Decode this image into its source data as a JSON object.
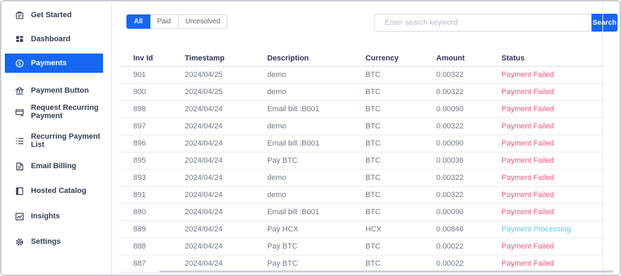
{
  "sidebar": {
    "items": [
      {
        "label": "Get Started",
        "icon": "clipboard-icon",
        "active": false
      },
      {
        "label": "Dashboard",
        "icon": "dashboard-icon",
        "active": false
      },
      {
        "label": "Payments",
        "icon": "payments-dollar-icon",
        "active": true
      },
      {
        "label": "Payment Button",
        "icon": "bank-icon",
        "active": false
      },
      {
        "label": "Request Recurring Payment",
        "icon": "card-icon",
        "active": false
      },
      {
        "label": "Recurring Payment List",
        "icon": "list-icon",
        "active": false
      },
      {
        "label": "Email Billing",
        "icon": "document-icon",
        "active": false
      },
      {
        "label": "Hosted Catalog",
        "icon": "book-icon",
        "active": false
      },
      {
        "label": "Insights",
        "icon": "chart-icon",
        "active": false
      },
      {
        "label": "Settings",
        "icon": "gear-icon",
        "active": false
      }
    ]
  },
  "filters": {
    "tabs": [
      {
        "label": "All",
        "active": true
      },
      {
        "label": "Paid",
        "active": false
      },
      {
        "label": "Unresolved",
        "active": false
      }
    ]
  },
  "search": {
    "placeholder": "Enter search keyword",
    "button_label": "Search"
  },
  "table": {
    "columns": [
      "Inv Id",
      "Timestamp",
      "Description",
      "Currency",
      "Amount",
      "Status"
    ],
    "rows": [
      {
        "inv_id": "901",
        "timestamp": "2024/04/25",
        "description": "demo",
        "currency": "BTC",
        "amount": "0.00322",
        "status": "Payment Failed"
      },
      {
        "inv_id": "900",
        "timestamp": "2024/04/25",
        "description": "demo",
        "currency": "BTC",
        "amount": "0.00322",
        "status": "Payment Failed"
      },
      {
        "inv_id": "898",
        "timestamp": "2024/04/24",
        "description": "Email bill :B001",
        "currency": "BTC",
        "amount": "0.00090",
        "status": "Payment Failed"
      },
      {
        "inv_id": "897",
        "timestamp": "2024/04/24",
        "description": "demo",
        "currency": "BTC",
        "amount": "0.00322",
        "status": "Payment Failed"
      },
      {
        "inv_id": "896",
        "timestamp": "2024/04/24",
        "description": "Email bill :B001",
        "currency": "BTC",
        "amount": "0.00090",
        "status": "Payment Failed"
      },
      {
        "inv_id": "895",
        "timestamp": "2024/04/24",
        "description": "Pay BTC",
        "currency": "BTC",
        "amount": "0.00036",
        "status": "Payment Failed"
      },
      {
        "inv_id": "893",
        "timestamp": "2024/04/24",
        "description": "demo",
        "currency": "BTC",
        "amount": "0.00322",
        "status": "Payment Failed"
      },
      {
        "inv_id": "891",
        "timestamp": "2024/04/24",
        "description": "demo",
        "currency": "BTC",
        "amount": "0.00322",
        "status": "Payment Failed"
      },
      {
        "inv_id": "890",
        "timestamp": "2024/04/24",
        "description": "Email bill :B001",
        "currency": "BTC",
        "amount": "0.00090",
        "status": "Payment Failed"
      },
      {
        "inv_id": "889",
        "timestamp": "2024/04/24",
        "description": "Pay HCX",
        "currency": "HCX",
        "amount": "0.00846",
        "status": "Payment Processing"
      },
      {
        "inv_id": "888",
        "timestamp": "2024/04/24",
        "description": "Pay BTC",
        "currency": "BTC",
        "amount": "0.00022",
        "status": "Payment Failed"
      },
      {
        "inv_id": "887",
        "timestamp": "2024/04/24",
        "description": "Pay BTC",
        "currency": "BTC",
        "amount": "0.00022",
        "status": "Payment Failed"
      }
    ]
  },
  "colors": {
    "accent": "#1766f0",
    "status_failed": "#f4547c",
    "status_processing": "#58c7f3"
  }
}
